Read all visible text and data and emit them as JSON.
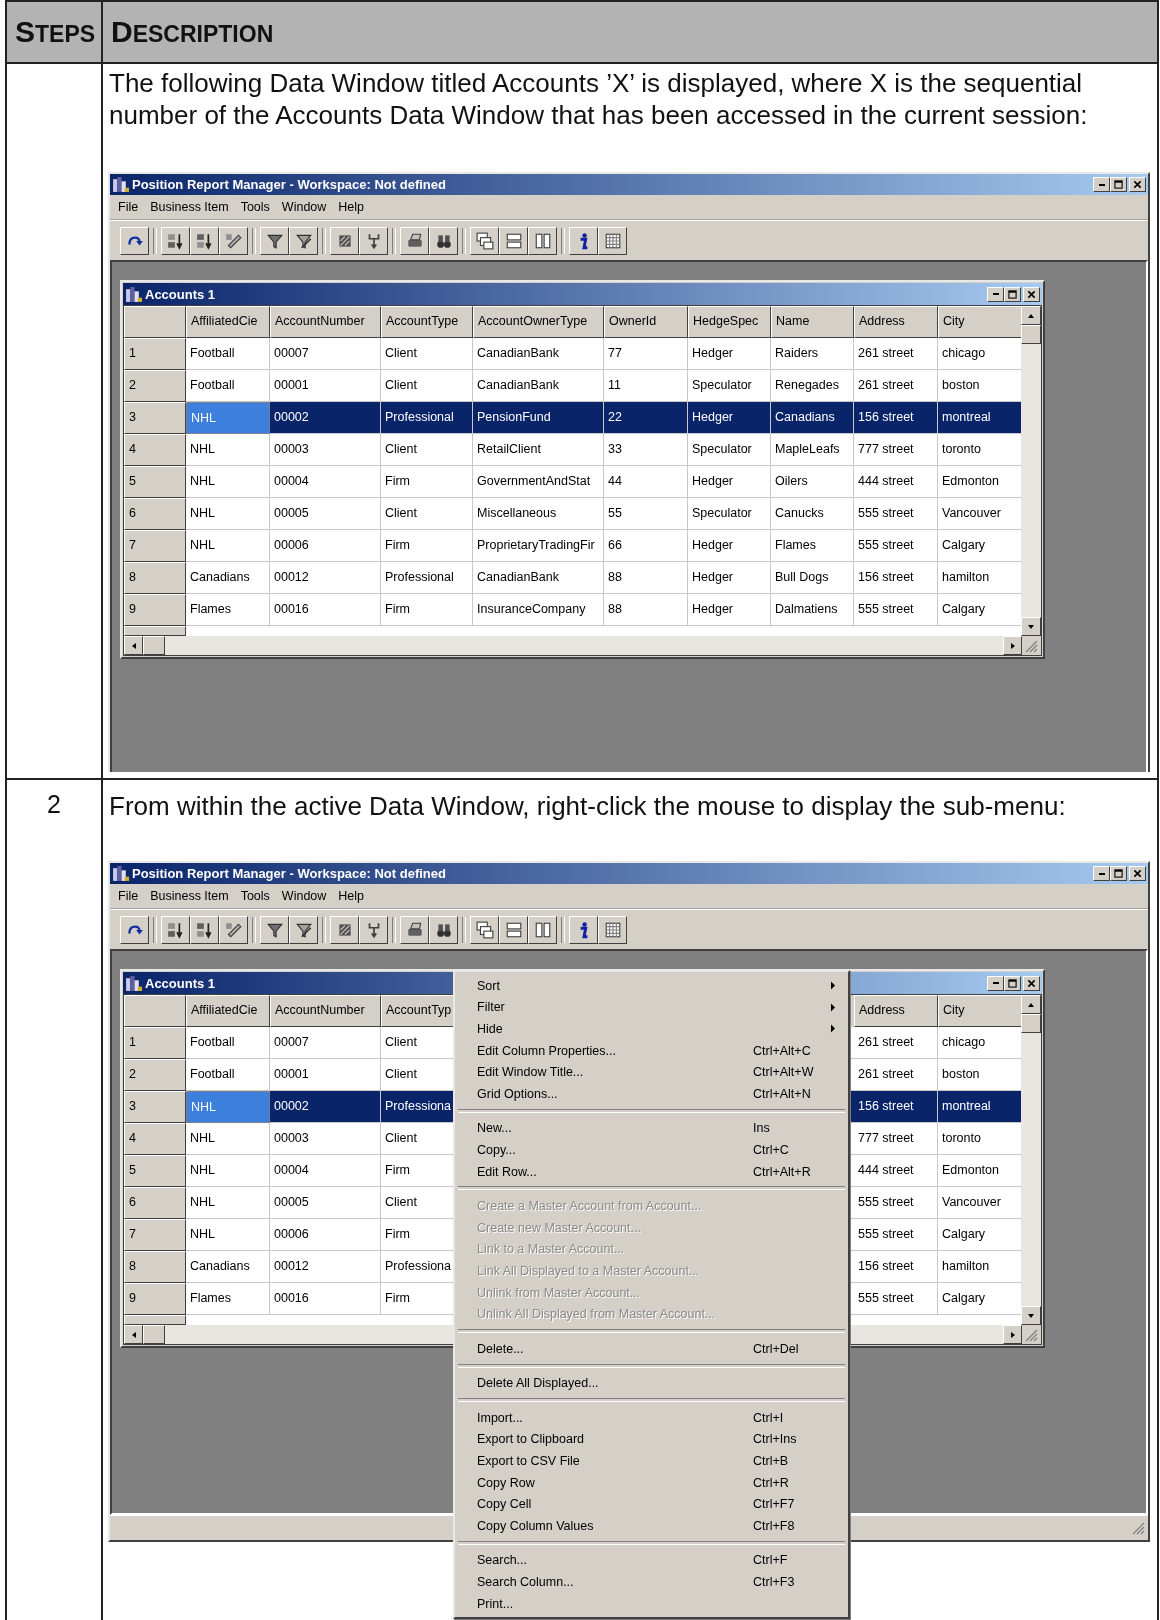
{
  "table": {
    "columns": [
      "STEPS",
      "DESCRIPTION"
    ]
  },
  "steps": [
    {
      "description": "The following Data Window titled Accounts ’X’ is displayed, where X is the sequential number of the Accounts Data Window that has been accessed in the current session:",
      "screenshot": {
        "window_title": "Position Report Manager - Workspace: Not defined",
        "menu_bar": [
          "File",
          "Business Item",
          "Tools",
          "Window",
          "Help"
        ],
        "child_window": {
          "title": "Accounts 1",
          "columns": [
            "AffiliatedCie",
            "AccountNumber",
            "AccountType",
            "AccountOwnerType",
            "OwnerId",
            "HedgeSpec",
            "Name",
            "Address",
            "City"
          ],
          "rows": [
            {
              "number": "1",
              "selected": false,
              "cells": [
                "Football",
                "00007",
                "Client",
                "CanadianBank",
                "77",
                "Hedger",
                "Raiders",
                "261 street",
                "chicago"
              ]
            },
            {
              "number": "2",
              "selected": false,
              "cells": [
                "Football",
                "00001",
                "Client",
                "CanadianBank",
                "11",
                "Speculator",
                "Renegades",
                "261 street",
                "boston"
              ]
            },
            {
              "number": "3",
              "selected": true,
              "cells": [
                "NHL",
                "00002",
                "Professional",
                "PensionFund",
                "22",
                "Hedger",
                "Canadians",
                "156 street",
                "montreal"
              ]
            },
            {
              "number": "4",
              "selected": false,
              "cells": [
                "NHL",
                "00003",
                "Client",
                "RetailClient",
                "33",
                "Speculator",
                "MapleLeafs",
                "777 street",
                "toronto"
              ]
            },
            {
              "number": "5",
              "selected": false,
              "cells": [
                "NHL",
                "00004",
                "Firm",
                "GovernmentAndStat",
                "44",
                "Hedger",
                "Oilers",
                "444 street",
                "Edmonton"
              ]
            },
            {
              "number": "6",
              "selected": false,
              "cells": [
                "NHL",
                "00005",
                "Client",
                "Miscellaneous",
                "55",
                "Speculator",
                "Canucks",
                "555 street",
                "Vancouver"
              ]
            },
            {
              "number": "7",
              "selected": false,
              "cells": [
                "NHL",
                "00006",
                "Firm",
                "ProprietaryTradingFir",
                "66",
                "Hedger",
                "Flames",
                "555 street",
                "Calgary"
              ]
            },
            {
              "number": "8",
              "selected": false,
              "cells": [
                "Canadians",
                "00012",
                "Professional",
                "CanadianBank",
                "88",
                "Hedger",
                "Bull Dogs",
                "156 street",
                "hamilton"
              ]
            },
            {
              "number": "9",
              "selected": false,
              "cells": [
                "Flames",
                "00016",
                "Firm",
                "InsuranceCompany",
                "88",
                "Hedger",
                "Dalmatiens",
                "555 street",
                "Calgary"
              ]
            }
          ]
        }
      }
    },
    {
      "number": "2",
      "description": "From within the active Data Window, right-click the mouse to display the sub-menu:",
      "screenshot": {
        "window_title": "Position Report Manager - Workspace: Not defined",
        "menu_bar": [
          "File",
          "Business Item",
          "Tools",
          "Window",
          "Help"
        ],
        "child_window": {
          "title": "Accounts 1",
          "columns": [
            "AffiliatedCie",
            "AccountNumber",
            "AccountTyp",
            "Address",
            "City"
          ],
          "rows": [
            {
              "number": "1",
              "selected": false,
              "cells": [
                "Football",
                "00007",
                "Client",
                "261 street",
                "chicago"
              ]
            },
            {
              "number": "2",
              "selected": false,
              "cells": [
                "Football",
                "00001",
                "Client",
                "261 street",
                "boston"
              ]
            },
            {
              "number": "3",
              "selected": true,
              "cells": [
                "NHL",
                "00002",
                "Professiona",
                "156 street",
                "montreal"
              ]
            },
            {
              "number": "4",
              "selected": false,
              "cells": [
                "NHL",
                "00003",
                "Client",
                "777 street",
                "toronto"
              ]
            },
            {
              "number": "5",
              "selected": false,
              "cells": [
                "NHL",
                "00004",
                "Firm",
                "444 street",
                "Edmonton"
              ]
            },
            {
              "number": "6",
              "selected": false,
              "cells": [
                "NHL",
                "00005",
                "Client",
                "555 street",
                "Vancouver"
              ]
            },
            {
              "number": "7",
              "selected": false,
              "cells": [
                "NHL",
                "00006",
                "Firm",
                "555 street",
                "Calgary"
              ]
            },
            {
              "number": "8",
              "selected": false,
              "cells": [
                "Canadians",
                "00012",
                "Professiona",
                "156 street",
                "hamilton"
              ]
            },
            {
              "number": "9",
              "selected": false,
              "cells": [
                "Flames",
                "00016",
                "Firm",
                "555 street",
                "Calgary"
              ]
            }
          ]
        },
        "context_menu": {
          "groups": [
            [
              {
                "label": "Sort",
                "submenu": true,
                "disabled": false
              },
              {
                "label": "Filter",
                "submenu": true,
                "disabled": false
              },
              {
                "label": "Hide",
                "submenu": true,
                "disabled": false
              },
              {
                "label": "Edit Column Properties...",
                "shortcut": "Ctrl+Alt+C",
                "submenu": false,
                "disabled": false
              },
              {
                "label": "Edit Window Title...",
                "shortcut": "Ctrl+Alt+W",
                "submenu": false,
                "disabled": false
              },
              {
                "label": "Grid Options...",
                "shortcut": "Ctrl+Alt+N",
                "submenu": false,
                "disabled": false
              }
            ],
            [
              {
                "label": "New...",
                "shortcut": "Ins",
                "submenu": false,
                "disabled": false
              },
              {
                "label": "Copy...",
                "shortcut": "Ctrl+C",
                "submenu": false,
                "disabled": false
              },
              {
                "label": "Edit Row...",
                "shortcut": "Ctrl+Alt+R",
                "submenu": false,
                "disabled": false
              }
            ],
            [
              {
                "label": "Create a Master Account from Account...",
                "submenu": false,
                "disabled": true
              },
              {
                "label": "Create new Master Account...",
                "submenu": false,
                "disabled": true
              },
              {
                "label": "Link to a Master Account...",
                "submenu": false,
                "disabled": true
              },
              {
                "label": "Link All Displayed to a Master Account...",
                "submenu": false,
                "disabled": true
              },
              {
                "label": "Unlink from Master Account...",
                "submenu": false,
                "disabled": true
              },
              {
                "label": "Unlink All Displayed from Master Account...",
                "submenu": false,
                "disabled": true
              }
            ],
            [
              {
                "label": "Delete...",
                "shortcut": "Ctrl+Del",
                "submenu": false,
                "disabled": false
              }
            ],
            [
              {
                "label": "Delete All Displayed...",
                "submenu": false,
                "disabled": false
              }
            ],
            [
              {
                "label": "Import...",
                "shortcut": "Ctrl+I",
                "submenu": false,
                "disabled": false
              },
              {
                "label": "Export to Clipboard",
                "shortcut": "Ctrl+Ins",
                "submenu": false,
                "disabled": false
              },
              {
                "label": "Export to CSV File",
                "shortcut": "Ctrl+B",
                "submenu": false,
                "disabled": false
              },
              {
                "label": "Copy Row",
                "shortcut": "Ctrl+R",
                "submenu": false,
                "disabled": false
              },
              {
                "label": "Copy Cell",
                "shortcut": "Ctrl+F7",
                "submenu": false,
                "disabled": false
              },
              {
                "label": "Copy Column Values",
                "shortcut": "Ctrl+F8",
                "submenu": false,
                "disabled": false
              }
            ],
            [
              {
                "label": "Search...",
                "shortcut": "Ctrl+F",
                "submenu": false,
                "disabled": false
              },
              {
                "label": "Search Column...",
                "shortcut": "Ctrl+F3",
                "submenu": false,
                "disabled": false
              },
              {
                "label": "Print...",
                "submenu": false,
                "disabled": false
              }
            ]
          ]
        }
      }
    }
  ]
}
